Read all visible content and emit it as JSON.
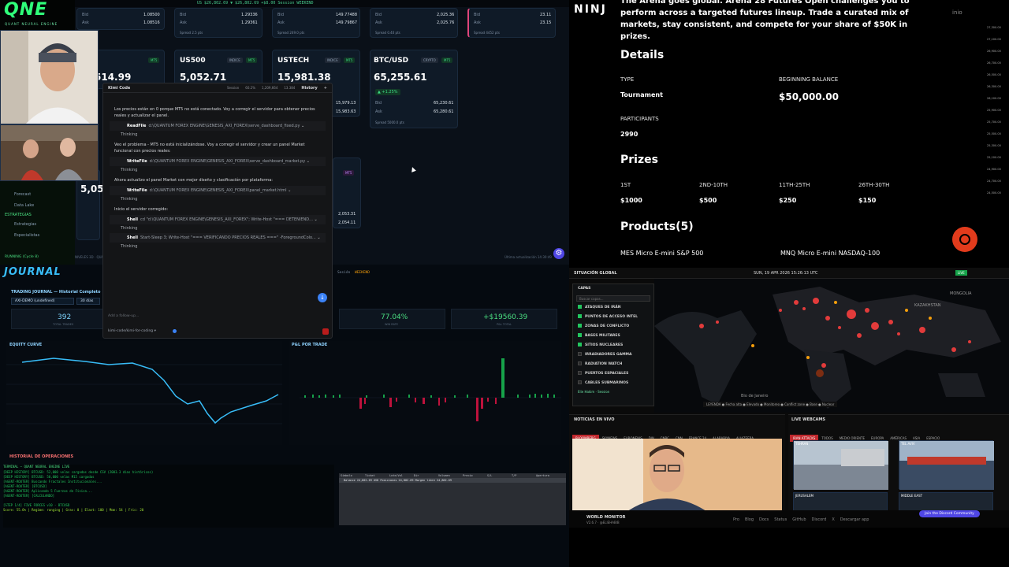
{
  "dashboard": {
    "ticker": "US  $26,802.69  ▼  $26,802.69   +$8.00   Session  WEEKEND",
    "markets_top": [
      {
        "bid": "1.08500",
        "ask": "1.08516"
      },
      {
        "bid": "1.29336",
        "ask": "1.29361",
        "spread": "Spread 2.5 pts"
      },
      {
        "bid": "149.77488",
        "ask": "149.79867",
        "spread": "Spread 249.0 pts"
      },
      {
        "bid": "2,025.36",
        "ask": "2,025.76",
        "spread": "Spread 0.40 pts"
      },
      {
        "bid": "23.11",
        "ask": "23.15",
        "spread": "Spread 4452 pts"
      }
    ],
    "cards": [
      {
        "name": "US500",
        "badge": "INDICE",
        "mt": "MT5",
        "price": "5,052.71"
      },
      {
        "name": "USTECH",
        "badge": "INDICE",
        "mt": "MT5",
        "price": "15,981.38",
        "bid": "15,979.13",
        "ask": "15,983.63"
      },
      {
        "name": "BTC/USD",
        "badge": "CRYPTO",
        "mt": "MT5",
        "price": "65,255.61",
        "change": "▲ +1.25%",
        "bid_label": "Bid",
        "bid": "65,230.61",
        "ask_label": "Ask",
        "ask": "65,280.61",
        "spread": "Spread 5000.0 pts"
      }
    ],
    "partial_price_1": "514.99",
    "partial_price_2": "5,05",
    "extra_values": [
      "2,053.31",
      "2,054.11"
    ],
    "last_update": "Última actualización 14:30:49",
    "gear_icon": "gear-icon"
  },
  "logo": {
    "text": "QNE",
    "sub": "QUANT NEURAL ENGINE"
  },
  "sidebar": {
    "items": [
      {
        "label": "Forecast"
      },
      {
        "label": "Data Lake"
      }
    ],
    "section": "ESTRATEGIAS",
    "items2": [
      {
        "label": "Estrategias"
      },
      {
        "label": "Especialistas"
      }
    ],
    "status": "RUNNING (Cycle 8)",
    "status_sub": "NIVELES 3D · QUANT"
  },
  "kimi": {
    "title": "Kimi Code",
    "session": "Session",
    "pct": "60.2%",
    "tokens": "1,209,664",
    "count": "13.384",
    "history": "History",
    "plus": "+",
    "messages": [
      {
        "type": "text",
        "text": "Los precios están en 0 porque MT5 no está conectado. Voy a corregir el servidor para obtener precios reales y actualizar el panel."
      },
      {
        "type": "tool",
        "name": "ReadFile",
        "arg": "d:\\QUANTUM FOREX ENGINE\\GENESIS_AXI_FOREX\\serve_dashboard_fixed.py"
      },
      {
        "type": "think",
        "text": "Thinking"
      },
      {
        "type": "text",
        "text": "Veo el problema - MT5 no está inicializándose. Voy a corregir el servidor y crear un panel Market funcional con precios reales:"
      },
      {
        "type": "tool",
        "name": "WriteFile",
        "arg": "d:\\QUANTUM FOREX ENGINE\\GENESIS_AXI_FOREX\\serve_dashboard_market.py"
      },
      {
        "type": "think",
        "text": "Thinking"
      },
      {
        "type": "text",
        "text": "Ahora actualizo el panel Market con mejor diseño y clasificación por plataforma:"
      },
      {
        "type": "tool",
        "name": "WriteFile",
        "arg": "d:\\QUANTUM FOREX ENGINE\\GENESIS_AXI_FOREX\\panel_market.html"
      },
      {
        "type": "think",
        "text": "Thinking"
      },
      {
        "type": "text",
        "text": "Inicio el servidor corregido:"
      },
      {
        "type": "tool",
        "name": "Shell",
        "arg": "cd \"d:\\QUANTUM FOREX ENGINE\\GENESIS_AXI_FOREX\"; Write-Host \"=== DETENIEND..."
      },
      {
        "type": "think",
        "text": "Thinking"
      },
      {
        "type": "tool",
        "name": "Shell",
        "arg": "Start-Sleep 3; Write-Host \"=== VERIFICANDO PRECIOS REALES ===\" -ForegroundColo..."
      },
      {
        "type": "think",
        "text": "Thinking"
      }
    ],
    "followup_placeholder": "Add a follow-up...",
    "model": "kimi-code/kimi-for-coding"
  },
  "journal": {
    "logo": "JOURNAL",
    "title": "TRADING JOURNAL — Historial Completo",
    "session_lbl": "Sesión",
    "session_val": "WEEKEND",
    "account": "AXI-DEMO (undefined)",
    "days": "30 días",
    "stats": [
      {
        "value": "392",
        "label": "TOTAL TRADES",
        "color": "#7dd3fc"
      },
      {
        "value": "77.04%",
        "label": "WIN RATE",
        "color": "#4ade80"
      },
      {
        "value": "+$19560.39",
        "label": "P&L TOTAL",
        "color": "#4ade80"
      }
    ],
    "equity_title": "EQUITY CURVE",
    "pnl_title": "P&L POR TRADE",
    "history_title": "HISTORIAL DE OPERACIONES",
    "terminal_title": "TERMINAL — QUANT NEURAL ENGINE LIVE",
    "terminal_lines": [
      "[DEEP HISTORY] BTCUSD: 52,000 velas cargadas desde CSV (2003.3 días históricos)",
      "[DEEP HISTORY] BTCUSD: 50,000 velas M15 cargadas",
      "[AGENT-ROUTER] Buscando Fractales Institucionales...",
      "[AGENT-ROUTER] [BTCUSD]",
      "[AGENT-ROUTER] Aplicando 5 Fuerzas de Física...",
      "[AGENT-ROUTER] [CALCULANDO]",
      "",
      "[STEP 1/4] FIVE FORCES v10 - BTCUSD",
      "Score: 55.6% | Regime: ranging | Grav: 0 | Elast: 100 | Mom: 54 | Fric: 20"
    ],
    "table_headers": [
      "Símbolo",
      "Ticket",
      "Lote/Vol",
      "Dir",
      "Volumen",
      "Precio",
      "S/L",
      "T/P",
      "Apertura"
    ],
    "table_row": "Balance 24,802.69 USD  Posiciones 24,802.69  Margen libre 24,802.69"
  },
  "arena": {
    "intro": "The Arena goes global. Arena 28 Futures Open challenges you to perform across a targeted futures lineup. Trade a curated mix of markets, stay consistent, and compete for your share of $50K in prizes.",
    "details_title": "Details",
    "type_label": "TYPE",
    "type_value": "Tournament",
    "balance_label": "BEGINNING BALANCE",
    "balance_value": "$50,000.00",
    "participants_label": "PARTICIPANTS",
    "participants_value": "2990",
    "prizes_title": "Prizes",
    "prizes": [
      {
        "label": "1ST",
        "value": "$1000"
      },
      {
        "label": "2ND-10TH",
        "value": "$500"
      },
      {
        "label": "11TH-25TH",
        "value": "$250"
      },
      {
        "label": "26TH-30TH",
        "value": "$150"
      }
    ],
    "products_title": "Products(5)",
    "products": [
      "MES Micro E-mini S&P 500",
      "MNQ Micro E-mini NASDAQ-100"
    ],
    "nin": "NINJ",
    "nio": "inio",
    "axis": [
      "27,300.00",
      "27,100.00",
      "26,900.00",
      "26,700.00",
      "26,500.00",
      "26,300.00",
      "26,100.00",
      "25,900.00",
      "25,700.00",
      "25,500.00",
      "25,300.00",
      "25,100.00",
      "24,900.00",
      "24,700.00",
      "24,500.00"
    ]
  },
  "world": {
    "title": "SITUACIÓN GLOBAL",
    "date": "SUN, 19 APR 2026 15:26:13 UTC",
    "live": "LIVE",
    "layers_title": "CAPAS",
    "search_placeholder": "Buscar capas...",
    "layers": [
      {
        "label": "ATAQUES DE IRÁN",
        "on": true
      },
      {
        "label": "PUNTOS DE ACCESO INTEL",
        "on": true
      },
      {
        "label": "ZONAS DE CONFLICTO",
        "on": true
      },
      {
        "label": "BASES MILITARES",
        "on": true
      },
      {
        "label": "SITIOS NUCLEARES",
        "on": true
      },
      {
        "label": "IRRADIADORES GAMMA",
        "on": false
      },
      {
        "label": "RADIATION WATCH",
        "on": false
      },
      {
        "label": "PUERTOS ESPACIALES",
        "on": false
      },
      {
        "label": "CABLES SUBMARINOS",
        "on": false
      }
    ],
    "layer_footer": "Elie Hakim · Session",
    "legend": "LEYENDA  ● Fecha alta  ● Elevado  ● Monitoreo  ● Conflict zone  ● Base  ● Nuclear",
    "map_labels": [
      "Bio de Janeiro",
      "KAZAKHSTAN",
      "MONGOLIA"
    ],
    "news_title": "NOTICIAS EN VIVO",
    "news_tabs": [
      "BLOOMBERG",
      "SKYNEWS",
      "EURONEWS",
      "DW",
      "CNBC",
      "CNN",
      "FRANCE 24",
      "ALARABIYA",
      "ALJAZEERA"
    ],
    "cams_title": "LIVE WEBCAMS",
    "cam_tabs": [
      "IRAN ATTACKS",
      "TODOS",
      "MEDIO ORIENTE",
      "EUROPA",
      "AMÉRICAS",
      "ASIA",
      "ESPACIO"
    ],
    "cam_labels": [
      "TEHRAN",
      "TEL AVIV",
      "JERUSALEM",
      "MIDDLE EAST"
    ],
    "footer_brand": "WORLD MONITOR",
    "footer_ver": "V2.6.7 · @ELIEHABIB",
    "footer_links": [
      "Pro",
      "Blog",
      "Docs",
      "Status",
      "GitHub",
      "Discord",
      "X",
      "Descargar app"
    ],
    "discord_btn": "Join the Discord Community"
  }
}
